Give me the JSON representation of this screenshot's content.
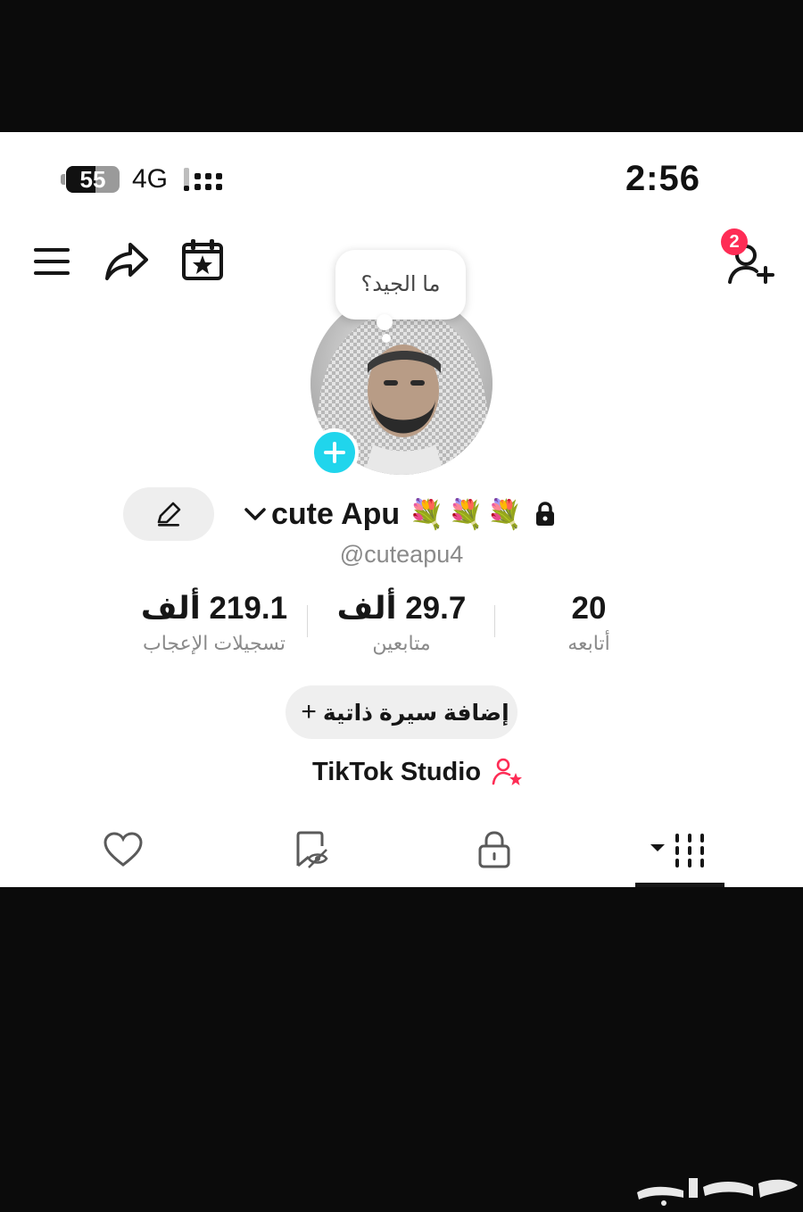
{
  "status_bar": {
    "battery_percent": "55",
    "battery_level": 0.55,
    "network": "4G",
    "time": "2:56"
  },
  "header": {
    "notification_count": "2",
    "icons": [
      "menu-icon",
      "share-icon",
      "calendar-star-icon",
      "add-friend-icon"
    ]
  },
  "profile": {
    "bubble_text": "ما الجيد؟",
    "display_name": "cute Apu",
    "decorations": "💐💐💐",
    "username": "@cuteapu4"
  },
  "stats": {
    "likes": {
      "value": "219.1 ألف",
      "label": "تسجيلات الإعجاب"
    },
    "followers": {
      "value": "29.7 ألف",
      "label": "متابعين"
    },
    "following": {
      "value": "20",
      "label": "أتابعه"
    }
  },
  "bio": {
    "button_label": "إضافة سيرة ذاتية",
    "plus": "+"
  },
  "studio": {
    "label": "TikTok Studio"
  },
  "tabs": [
    {
      "name": "videos",
      "icon": "grid-icon",
      "selected": true
    },
    {
      "name": "private",
      "icon": "lock-icon",
      "selected": false
    },
    {
      "name": "favorites",
      "icon": "bookmark-icon",
      "selected": false
    },
    {
      "name": "liked",
      "icon": "heart-icon",
      "selected": false
    }
  ],
  "colors": {
    "accent_pink": "#fe2c55",
    "avatar_add_cyan": "#20d5ec",
    "text_primary": "#161616",
    "text_secondary": "#8a8a8a"
  },
  "watermark": "حراج"
}
